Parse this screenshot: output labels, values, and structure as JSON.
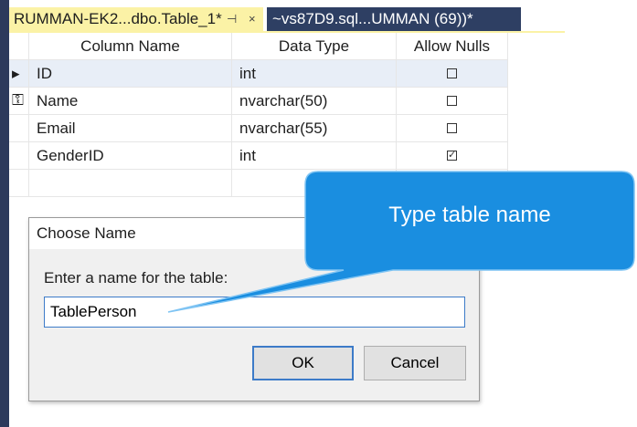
{
  "tabs": {
    "active_label": "RUMMAN-EK2...dbo.Table_1*",
    "active_pin": "⊣",
    "active_close": "",
    "inactive_label": "~vs87D9.sql...UMMAN (69))*"
  },
  "grid": {
    "headers": {
      "name": "Column Name",
      "type": "Data Type",
      "nulls": "Allow Nulls"
    },
    "rows": [
      {
        "name": "ID",
        "type": "int",
        "allow_nulls": false,
        "primary_key": true
      },
      {
        "name": "Name",
        "type": "nvarchar(50)",
        "allow_nulls": false
      },
      {
        "name": "Email",
        "type": "nvarchar(55)",
        "allow_nulls": false
      },
      {
        "name": "GenderID",
        "type": "int",
        "allow_nulls": true
      }
    ],
    "row_marker": "▸⚿"
  },
  "dialog": {
    "title": "Choose Name",
    "prompt": "Enter a name for the table:",
    "input_value": "TablePerson",
    "ok_label": "OK",
    "cancel_label": "Cancel"
  },
  "callout": {
    "text": "Type table name",
    "color": "#1a8ee0"
  }
}
